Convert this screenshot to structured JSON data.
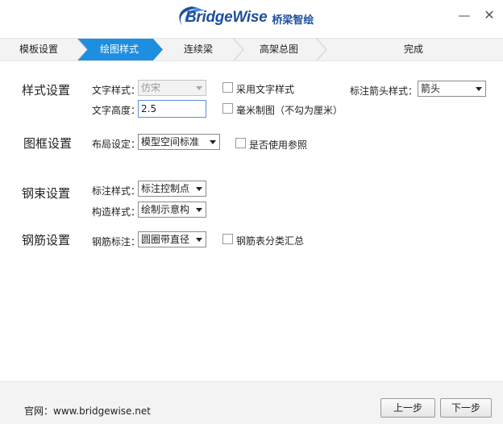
{
  "app": {
    "logo_text": "BridgeWise",
    "logo_cn": "桥梁智绘",
    "minimize_glyph": "—",
    "close_glyph": "✕"
  },
  "steps": [
    {
      "label": "模板设置",
      "active": false
    },
    {
      "label": "绘图样式",
      "active": true
    },
    {
      "label": "连续梁",
      "active": false
    },
    {
      "label": "高架总图",
      "active": false
    },
    {
      "label": "完成",
      "active": false
    }
  ],
  "colors": {
    "active_step": "#1e8ee0",
    "brand": "#1c4f9c"
  },
  "style_settings": {
    "title": "样式设置",
    "text_style_label": "文字样式：",
    "text_style_value": "仿宋",
    "use_text_style_label": "采用文字样式",
    "use_text_style_checked": false,
    "text_height_label": "文字高度：",
    "text_height_value": "2.5",
    "mm_drawing_label": "毫米制图（不勾为厘米）",
    "mm_drawing_checked": false,
    "arrow_style_label": "标注箭头样式：",
    "arrow_style_value": "箭头"
  },
  "frame_settings": {
    "title": "图框设置",
    "layout_label": "布局设定：",
    "layout_value": "模型空间标准",
    "use_xref_label": "是否使用参照",
    "use_xref_checked": false
  },
  "tendon_settings": {
    "title": "钢束设置",
    "annotation_style_label": "标注样式：",
    "annotation_style_value": "标注控制点",
    "construct_style_label": "构造样式：",
    "construct_style_value": "绘制示意构"
  },
  "rebar_settings": {
    "title": "钢筋设置",
    "rebar_annotation_label": "钢筋标注：",
    "rebar_annotation_value": "圆圈带直径",
    "rebar_summary_label": "钢筋表分类汇总",
    "rebar_summary_checked": false
  },
  "footer": {
    "website": "官网：www.bridgewise.net",
    "prev_label": "上一步",
    "next_label": "下一步"
  }
}
